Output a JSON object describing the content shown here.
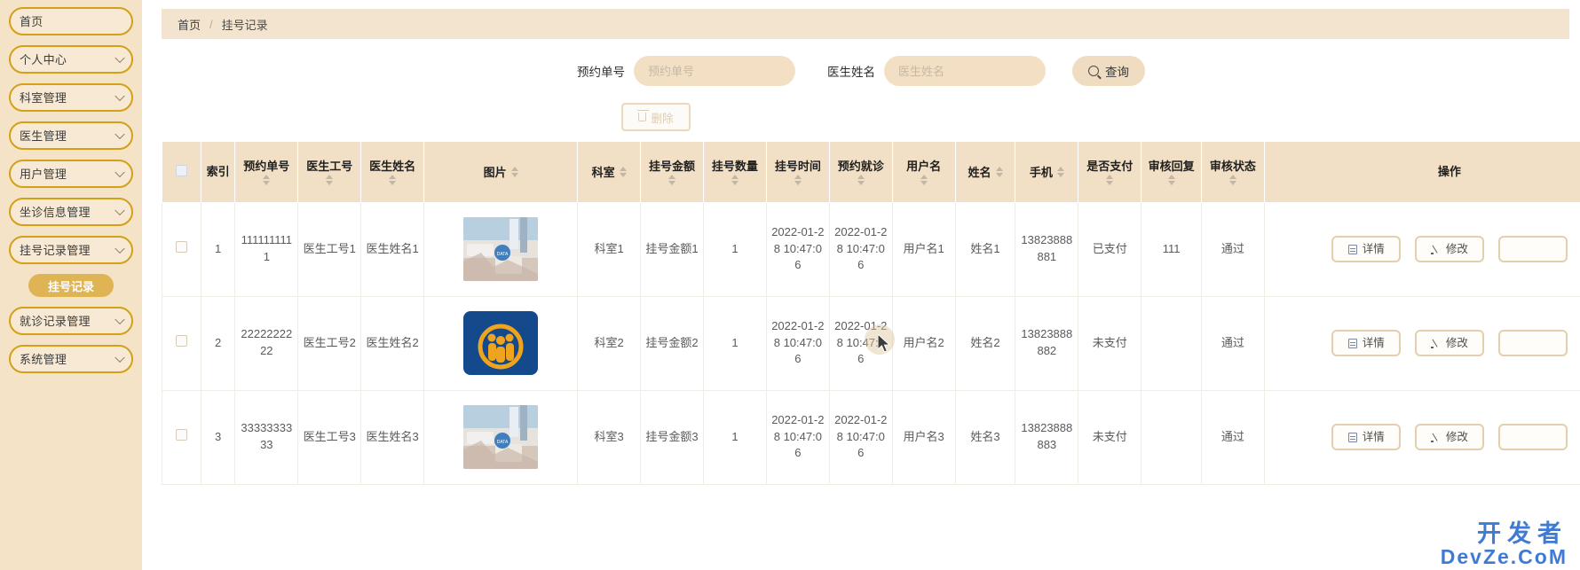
{
  "sidebar": {
    "items": [
      {
        "label": "首页",
        "expandable": false,
        "active": false
      },
      {
        "label": "个人中心",
        "expandable": true,
        "active": false
      },
      {
        "label": "科室管理",
        "expandable": true,
        "active": false
      },
      {
        "label": "医生管理",
        "expandable": true,
        "active": false
      },
      {
        "label": "用户管理",
        "expandable": true,
        "active": false
      },
      {
        "label": "坐诊信息管理",
        "expandable": true,
        "active": false
      },
      {
        "label": "挂号记录管理",
        "expandable": true,
        "active": true
      }
    ],
    "sub_item": {
      "label": "挂号记录"
    },
    "items_after": [
      {
        "label": "就诊记录管理",
        "expandable": true,
        "active": false
      },
      {
        "label": "系统管理",
        "expandable": true,
        "active": false
      }
    ]
  },
  "breadcrumb": {
    "home": "首页",
    "separator": "/",
    "current": "挂号记录"
  },
  "search": {
    "order_label": "预约单号",
    "order_value": "",
    "order_placeholder": "预约单号",
    "doctor_label": "医生姓名",
    "doctor_value": "",
    "doctor_placeholder": "医生姓名",
    "button_label": "查询",
    "button_icon": "search-icon"
  },
  "toolbar": {
    "delete_label": "删除",
    "delete_icon": "trash-icon"
  },
  "table": {
    "columns": [
      {
        "key": "checkbox",
        "label": "",
        "sortable": false,
        "inline": false
      },
      {
        "key": "index",
        "label": "索引",
        "sortable": false,
        "inline": false
      },
      {
        "key": "order_no",
        "label": "预约单号",
        "sortable": true,
        "inline": false
      },
      {
        "key": "doctor_no",
        "label": "医生工号",
        "sortable": true,
        "inline": false
      },
      {
        "key": "doctor_name",
        "label": "医生姓名",
        "sortable": true,
        "inline": false
      },
      {
        "key": "image",
        "label": "图片",
        "sortable": true,
        "inline": true
      },
      {
        "key": "department",
        "label": "科室",
        "sortable": true,
        "inline": true
      },
      {
        "key": "amount",
        "label": "挂号金额",
        "sortable": true,
        "inline": false
      },
      {
        "key": "quantity",
        "label": "挂号数量",
        "sortable": true,
        "inline": false
      },
      {
        "key": "reg_time",
        "label": "挂号时间",
        "sortable": true,
        "inline": false
      },
      {
        "key": "appt_time",
        "label": "预约就诊",
        "sortable": true,
        "inline": false
      },
      {
        "key": "username",
        "label": "用户名",
        "sortable": true,
        "inline": false
      },
      {
        "key": "name",
        "label": "姓名",
        "sortable": true,
        "inline": true
      },
      {
        "key": "phone",
        "label": "手机",
        "sortable": true,
        "inline": true
      },
      {
        "key": "paid",
        "label": "是否支付",
        "sortable": true,
        "inline": false
      },
      {
        "key": "review_reply",
        "label": "审核回复",
        "sortable": true,
        "inline": false
      },
      {
        "key": "review_status",
        "label": "审核状态",
        "sortable": true,
        "inline": false
      },
      {
        "key": "operations",
        "label": "操作",
        "sortable": false,
        "inline": false
      }
    ],
    "rows": [
      {
        "index": "1",
        "order_no": "1111111111",
        "doctor_no": "医生工号1",
        "doctor_name": "医生姓名1",
        "image": "photo-hospital",
        "department": "科室1",
        "amount": "挂号金额1",
        "quantity": "1",
        "reg_time": "2022-01-28 10:47:06",
        "appt_time": "2022-01-28 10:47:06",
        "username": "用户名1",
        "name": "姓名1",
        "phone": "13823888881",
        "paid": "已支付",
        "review_reply": "111",
        "review_status": "通过"
      },
      {
        "index": "2",
        "order_no": "2222222222",
        "doctor_no": "医生工号2",
        "doctor_name": "医生姓名2",
        "image": "logo-blue-family",
        "department": "科室2",
        "amount": "挂号金额2",
        "quantity": "1",
        "reg_time": "2022-01-28 10:47:06",
        "appt_time": "2022-01-28 10:47:06",
        "username": "用户名2",
        "name": "姓名2",
        "phone": "13823888882",
        "paid": "未支付",
        "review_reply": "",
        "review_status": "通过"
      },
      {
        "index": "3",
        "order_no": "3333333333",
        "doctor_no": "医生工号3",
        "doctor_name": "医生姓名3",
        "image": "photo-hospital",
        "department": "科室3",
        "amount": "挂号金额3",
        "quantity": "1",
        "reg_time": "2022-01-28 10:47:06",
        "appt_time": "2022-01-28 10:47:06",
        "username": "用户名3",
        "name": "姓名3",
        "phone": "13823888883",
        "paid": "未支付",
        "review_reply": "",
        "review_status": "通过"
      }
    ],
    "row_actions": {
      "detail_label": "详情",
      "detail_icon": "document-icon",
      "edit_label": "修改",
      "edit_icon": "pencil-icon"
    }
  },
  "watermark": {
    "line1": "开发者",
    "line2": "DevZe.CoM"
  },
  "colors": {
    "sidebar_bg": "#f5e3c8",
    "nav_border": "#d4a017",
    "accent": "#dfb455",
    "header_bg": "#f2e0c6",
    "input_bg": "#f3dfc4",
    "watermark": "#2f6fd0"
  }
}
